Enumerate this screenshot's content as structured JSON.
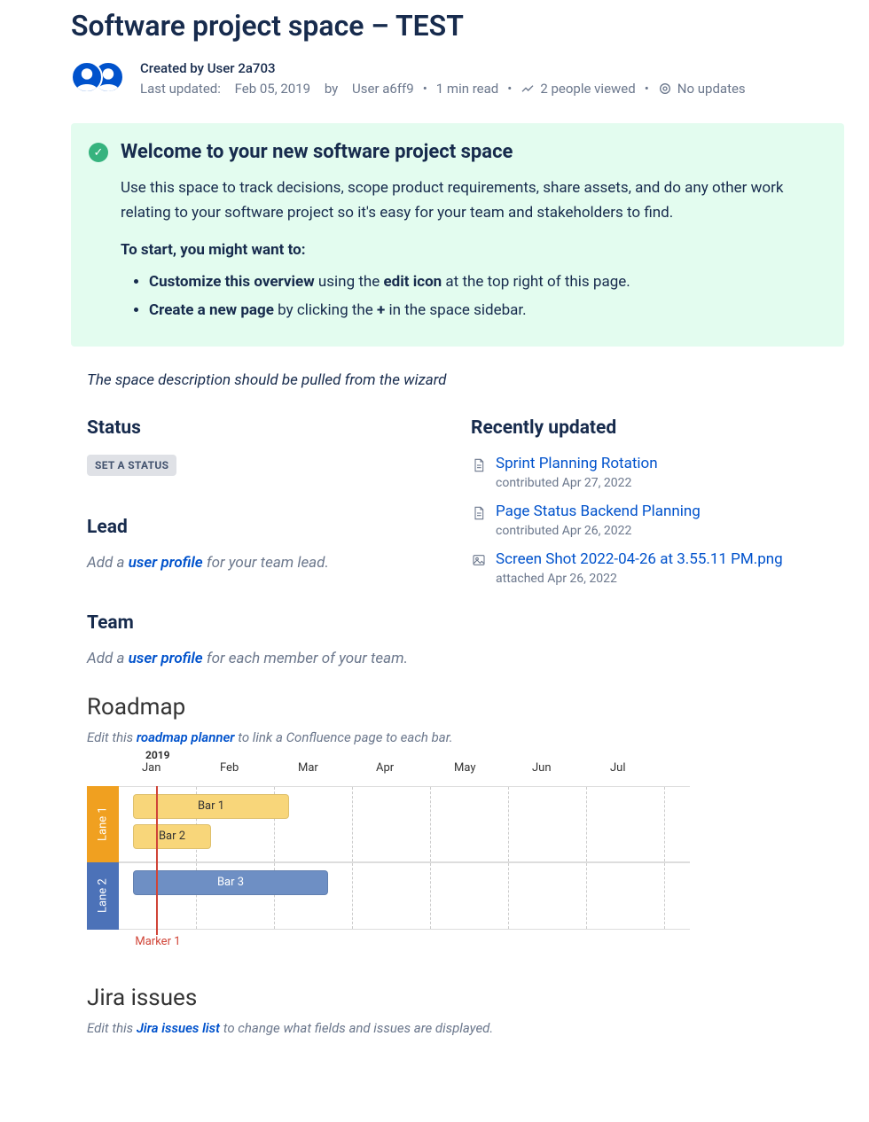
{
  "page": {
    "title": "Software project space – TEST"
  },
  "byline": {
    "created_by_label": "Created by",
    "created_by_user": "User 2a703",
    "last_updated_label": "Last updated:",
    "last_updated_date": "Feb 05, 2019",
    "last_updated_by_prefix": "by",
    "last_updated_user": "User a6ff9",
    "read_time": "1 min read",
    "viewers": "2 people viewed",
    "no_updates": "No updates"
  },
  "welcome_panel": {
    "heading": "Welcome to your new software project space",
    "body": "Use this space to track decisions, scope product requirements, share assets, and do any other work relating to your software project so it's easy for your team and stakeholders to find.",
    "subheading": "To start, you might want to:",
    "bullets": [
      {
        "b1": "Customize this overview",
        "mid": " using the ",
        "b2": "edit icon",
        "tail": " at the top right of this page."
      },
      {
        "b1": "Create a new page",
        "mid": " by clicking the ",
        "b2": "+",
        "tail": " in the space sidebar."
      }
    ]
  },
  "wizard_note": "The space description should be pulled from the wizard",
  "status": {
    "heading": "Status",
    "pill": "SET A STATUS"
  },
  "lead": {
    "heading": "Lead",
    "prompt_before": "Add a ",
    "link": "user profile",
    "prompt_after": " for your team lead."
  },
  "team": {
    "heading": "Team",
    "prompt_before": "Add a ",
    "link": "user profile",
    "prompt_after": " for each member of your team."
  },
  "recent": {
    "heading": "Recently updated",
    "items": [
      {
        "icon": "page",
        "title": "Sprint Planning Rotation",
        "meta": "contributed Apr 27, 2022"
      },
      {
        "icon": "page",
        "title": "Page Status Backend Planning",
        "meta": "contributed Apr 26, 2022"
      },
      {
        "icon": "image",
        "title": "Screen Shot 2022-04-26 at 3.55.11 PM.png",
        "meta": "attached Apr 26, 2022"
      }
    ]
  },
  "roadmap": {
    "heading": "Roadmap",
    "note_before": "Edit this ",
    "note_link": "roadmap planner",
    "note_after": " to link a Confluence page to each bar.",
    "marker": "Marker 1"
  },
  "jira": {
    "heading": "Jira issues",
    "note_before": "Edit this ",
    "note_link": "Jira issues list",
    "note_after": " to change what fields and issues are displayed."
  },
  "chart_data": {
    "type": "gantt",
    "year": "2019",
    "months": [
      "Jan",
      "Feb",
      "Mar",
      "Apr",
      "May",
      "Jun",
      "Jul"
    ],
    "lanes": [
      {
        "name": "Lane 1",
        "color": "#F0A020",
        "bars": [
          {
            "label": "Bar 1",
            "start_month": 0,
            "span_months": 2.0,
            "color": "yellow"
          },
          {
            "label": "Bar 2",
            "start_month": 0,
            "span_months": 1.0,
            "color": "yellow"
          }
        ]
      },
      {
        "name": "Lane 2",
        "color": "#4C72B8",
        "bars": [
          {
            "label": "Bar 3",
            "start_month": 0,
            "span_months": 2.5,
            "color": "blue"
          }
        ]
      }
    ],
    "markers": [
      {
        "label": "Marker 1",
        "month": 0.3
      }
    ]
  }
}
